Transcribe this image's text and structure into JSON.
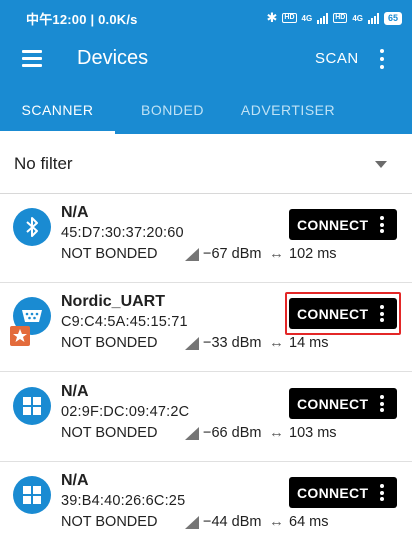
{
  "status_bar": {
    "time_speed": "中午12:00 | 0.0K/s",
    "hd_tag": "HD",
    "net_1": "4G",
    "net_2": "4G",
    "battery": "65"
  },
  "app_bar": {
    "title": "Devices",
    "scan_label": "SCAN",
    "icons": [
      "menu-icon",
      "overflow-icon"
    ]
  },
  "tabs": [
    {
      "label": "SCANNER",
      "active": true
    },
    {
      "label": "BONDED",
      "active": false
    },
    {
      "label": "ADVERTISER",
      "active": false
    }
  ],
  "filter": {
    "selected": "No filter"
  },
  "devices": [
    {
      "name": "N/A",
      "address": "45:D7:30:37:20:60",
      "bond_state": "NOT BONDED",
      "rssi": "−67 dBm",
      "interval": "102 ms",
      "connect_label": "CONNECT",
      "icon": "bluetooth-icon",
      "highlighted": false
    },
    {
      "name": "Nordic_UART",
      "address": "C9:C4:5A:45:15:71",
      "bond_state": "NOT BONDED",
      "rssi": "−33 dBm",
      "interval": "14 ms",
      "connect_label": "CONNECT",
      "icon": "uart-icon",
      "highlighted": true
    },
    {
      "name": "N/A",
      "address": "02:9F:DC:09:47:2C",
      "bond_state": "NOT BONDED",
      "rssi": "−66 dBm",
      "interval": "103 ms",
      "connect_label": "CONNECT",
      "icon": "windows-icon",
      "highlighted": false
    },
    {
      "name": "N/A",
      "address": "39:B4:40:26:6C:25",
      "bond_state": "NOT BONDED",
      "rssi": "−44 dBm",
      "interval": "64 ms",
      "connect_label": "CONNECT",
      "icon": "windows-icon",
      "highlighted": false
    }
  ],
  "colors": {
    "primary": "#1a8bd2",
    "connect_button": "#000000",
    "highlight": "#e32727",
    "badge": "#e36b3b"
  }
}
